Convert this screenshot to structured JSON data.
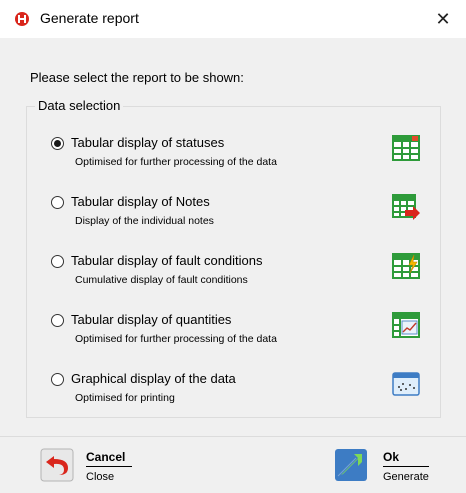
{
  "window": {
    "title": "Generate report",
    "close_glyph": "✕",
    "app_icon": "logo-icon"
  },
  "prompt": "Please select the report to be shown:",
  "group": {
    "legend": "Data selection",
    "options": [
      {
        "label": "Tabular display of statuses",
        "description": "Optimised for further processing of the data",
        "checked": true,
        "icon": "table-status-icon"
      },
      {
        "label": "Tabular display of Notes",
        "description": "Display of the individual notes",
        "checked": false,
        "icon": "table-notes-icon"
      },
      {
        "label": "Tabular display of fault conditions",
        "description": "Cumulative display of fault conditions",
        "checked": false,
        "icon": "table-fault-icon"
      },
      {
        "label": "Tabular display of quantities",
        "description": "Optimised for further processing of the data",
        "checked": false,
        "icon": "table-chart-icon"
      },
      {
        "label": "Graphical display of the data",
        "description": "Optimised for printing",
        "checked": false,
        "icon": "graph-window-icon"
      }
    ]
  },
  "buttons": {
    "cancel": {
      "title": "Cancel",
      "subtitle": "Close",
      "icon": "undo-arrow-icon"
    },
    "ok": {
      "title": "Ok",
      "subtitle": "Generate",
      "icon": "check-arrow-icon"
    }
  },
  "colors": {
    "brand": "#d9261c",
    "table_green": "#2e9b3a",
    "background": "#f0f0f0"
  }
}
